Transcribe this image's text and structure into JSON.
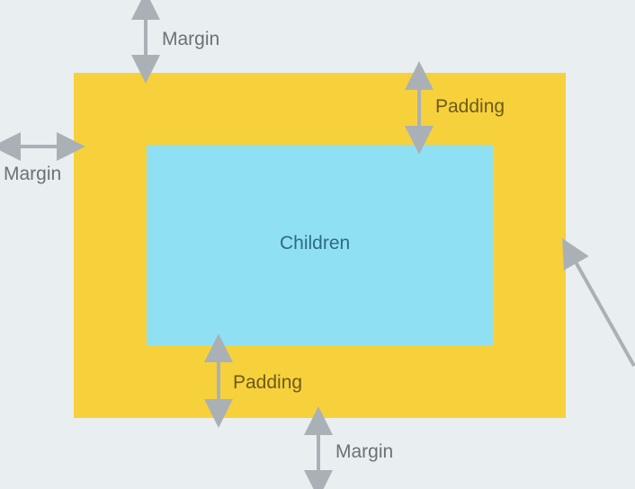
{
  "diagram": {
    "labels": {
      "margin_top": "Margin",
      "margin_left": "Margin",
      "margin_bottom": "Margin",
      "padding_top": "Padding",
      "padding_bottom": "Padding",
      "children": "Children"
    },
    "colors": {
      "background": "#e9eef0",
      "padding_box": "#f7d13b",
      "children_box": "#90e0f4",
      "arrow": "#a9b1b6",
      "margin_text": "#6b7175",
      "padding_text": "#6b5a1c",
      "children_text": "#2f6b80"
    }
  }
}
